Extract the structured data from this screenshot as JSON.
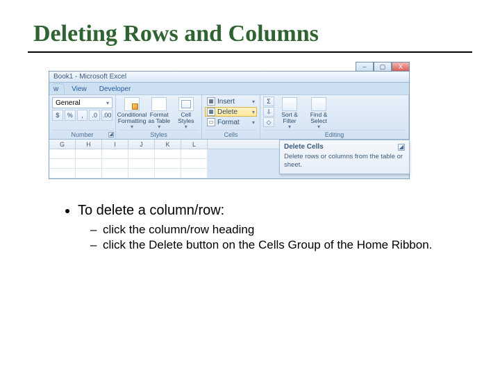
{
  "title": "Deleting Rows and Columns",
  "excel": {
    "window_title": "Book1 - Microsoft Excel",
    "win_controls": {
      "min": "–",
      "max": "▢",
      "close": "X"
    },
    "tabs": {
      "partial": "w",
      "view": "View",
      "developer": "Developer"
    },
    "number": {
      "format_value": "General",
      "btns": [
        "$",
        "%",
        ",",
        ".0",
        ".00"
      ],
      "label": "Number"
    },
    "styles": {
      "cond_fmt": "Conditional Formatting",
      "fmt_table": "Format as Table",
      "cell_styles": "Cell Styles",
      "dd": "▾",
      "label": "Styles"
    },
    "cells": {
      "insert": "Insert",
      "delete": "Delete",
      "format": "Format",
      "dd": "▾",
      "label": "Cells"
    },
    "editing": {
      "sigma": "Σ",
      "fill": "⇩",
      "clear": "◇",
      "sort": "Sort & Filter",
      "find": "Find & Select",
      "dd": "▾",
      "label": "Editing"
    },
    "columns": [
      "G",
      "H",
      "I",
      "J",
      "K",
      "L"
    ],
    "tooltip": {
      "title": "Delete Cells",
      "body": "Delete rows or columns from the table or sheet."
    }
  },
  "bullets": {
    "main": "To delete a column/row:",
    "sub1": " click the column/row heading",
    "sub2": "click the Delete button on the Cells Group of the Home Ribbon."
  }
}
